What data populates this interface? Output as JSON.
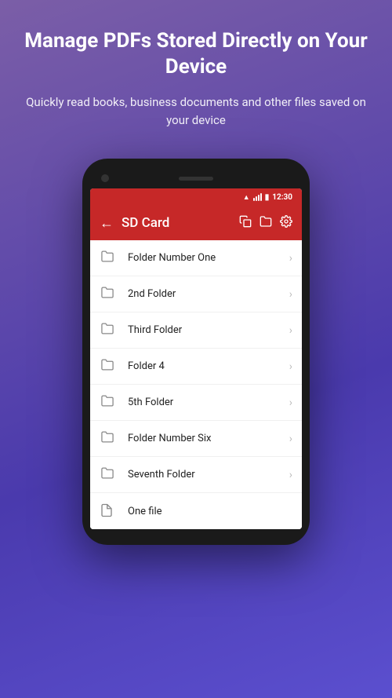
{
  "hero": {
    "title": "Manage PDFs Stored Directly on Your Device",
    "subtitle": "Quickly read books, business documents and other files saved on your device"
  },
  "status_bar": {
    "time": "12:30"
  },
  "toolbar": {
    "title": "SD Card",
    "back_label": "←"
  },
  "file_list": [
    {
      "id": 1,
      "name": "Folder Number One",
      "type": "folder"
    },
    {
      "id": 2,
      "name": "2nd Folder",
      "type": "folder"
    },
    {
      "id": 3,
      "name": "Third Folder",
      "type": "folder"
    },
    {
      "id": 4,
      "name": "Folder 4",
      "type": "folder"
    },
    {
      "id": 5,
      "name": "5th Folder",
      "type": "folder"
    },
    {
      "id": 6,
      "name": "Folder Number Six",
      "type": "folder"
    },
    {
      "id": 7,
      "name": "Seventh Folder",
      "type": "folder"
    },
    {
      "id": 8,
      "name": "One file",
      "type": "file"
    }
  ],
  "icons": {
    "back": "←",
    "chevron_right": "›"
  }
}
